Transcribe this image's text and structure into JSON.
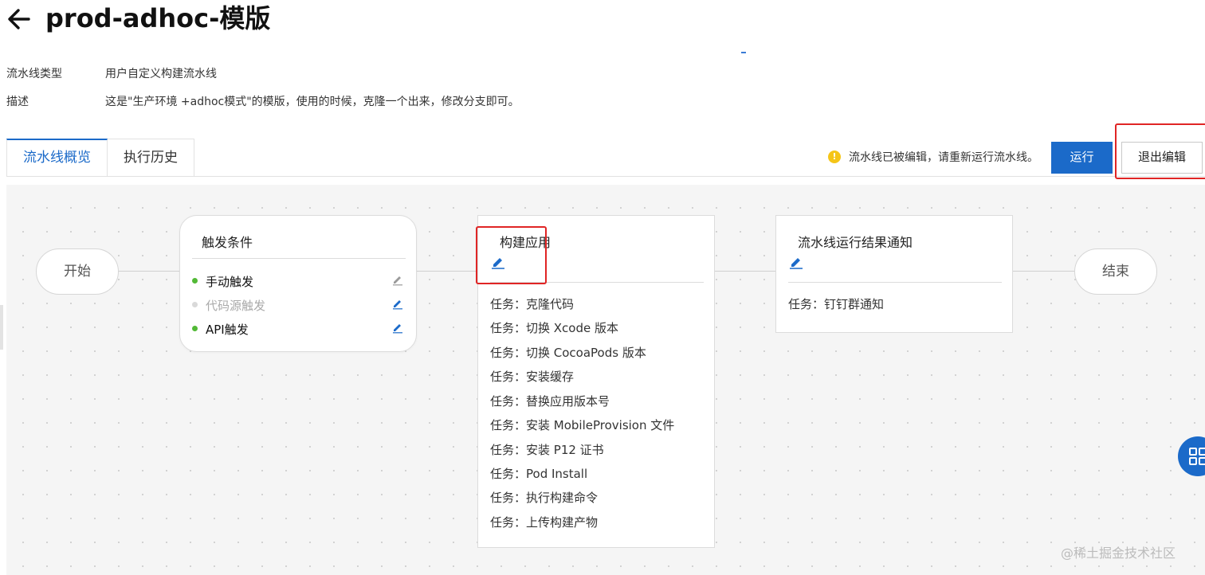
{
  "header": {
    "title": "prod-adhoc-模版"
  },
  "meta": [
    {
      "key": "流水线类型",
      "value": "用户自定义构建流水线"
    },
    {
      "key": "描述",
      "value": "这是\"生产环境 +adhoc模式\"的模版，使用的时候，克隆一个出来，修改分支即可。"
    }
  ],
  "tabs": [
    {
      "label": "流水线概览",
      "active": true
    },
    {
      "label": "执行历史",
      "active": false
    }
  ],
  "toolbar": {
    "notice": "流水线已被编辑，请重新运行流水线。",
    "run_label": "运行",
    "exit_label": "退出编辑"
  },
  "pipeline": {
    "start_label": "开始",
    "end_label": "结束",
    "trigger": {
      "title": "触发条件",
      "items": [
        {
          "label": "手动触发",
          "enabled": true
        },
        {
          "label": "代码源触发",
          "enabled": false
        },
        {
          "label": "API触发",
          "enabled": true
        }
      ]
    },
    "build": {
      "title": "构建应用",
      "tasks": [
        "任务：克隆代码",
        "任务：切换 Xcode 版本",
        "任务：切换 CocoaPods 版本",
        "任务：安装缓存",
        "任务：替换应用版本号",
        "任务：安装 MobileProvision 文件",
        "任务：安装 P12 证书",
        "任务：Pod Install",
        "任务：执行构建命令",
        "任务：上传构建产物"
      ]
    },
    "notify": {
      "title": "流水线运行结果通知",
      "tasks": [
        "任务：钉钉群通知"
      ]
    }
  },
  "watermark": "@稀土掘金技术社区",
  "colors": {
    "accent": "#1b6ac9",
    "enabled_dot": "#52b936",
    "disabled_dot": "#d9d9d9",
    "warning": "#f5c518",
    "highlight": "#e02525"
  }
}
